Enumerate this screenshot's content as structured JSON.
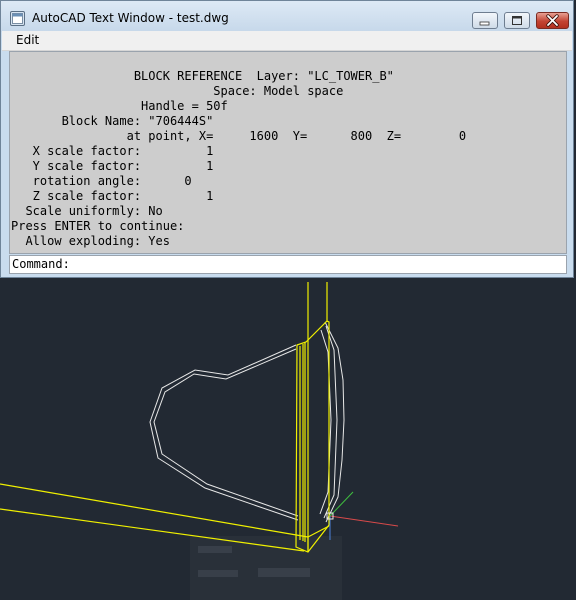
{
  "window": {
    "title": "AutoCAD Text Window - test.dwg",
    "icon": "autocad-app-icon",
    "controls": [
      "minimize-icon",
      "maximize-icon",
      "close-icon"
    ]
  },
  "menu": {
    "edit": "Edit"
  },
  "output": {
    "lines": [
      "                 BLOCK REFERENCE  Layer: \"LC_TOWER_B\"",
      "                            Space: Model space",
      "                  Handle = 50f",
      "       Block Name: \"706444S\"",
      "                at point, X=     1600  Y=      800  Z=        0",
      "   X scale factor:         1",
      "   Y scale factor:         1",
      "   rotation angle:      0",
      "   Z scale factor:         1",
      "  Scale uniformly: No",
      "Press ENTER to continue:",
      "  Allow exploding: Yes"
    ]
  },
  "command": {
    "label": "Command:",
    "value": ""
  },
  "colors": {
    "model_background": "#222933",
    "selection_yellow": "#f0f000",
    "object_white": "#e8e8e8",
    "axis_red": "#d94a4a",
    "axis_green": "#3fbf3f"
  }
}
